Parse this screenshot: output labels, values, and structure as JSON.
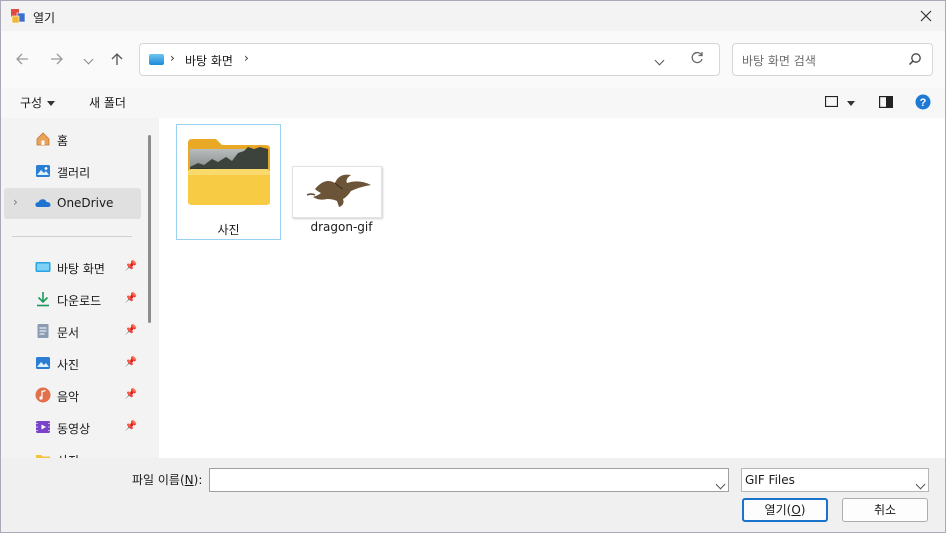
{
  "window": {
    "title": "열기"
  },
  "nav": {
    "breadcrumb": "바탕 화면",
    "search_placeholder": "바탕 화면 검색"
  },
  "commands": {
    "organize": "구성",
    "new_folder": "새 폴더"
  },
  "sidebar": {
    "items": [
      {
        "label": "홈",
        "icon": "home-icon"
      },
      {
        "label": "갤러리",
        "icon": "gallery-icon"
      },
      {
        "label": "OneDrive",
        "icon": "cloud-icon"
      },
      {
        "label": "바탕 화면",
        "icon": "desktop-icon"
      },
      {
        "label": "다운로드",
        "icon": "download-icon"
      },
      {
        "label": "문서",
        "icon": "document-icon"
      },
      {
        "label": "사진",
        "icon": "pictures-icon"
      },
      {
        "label": "음악",
        "icon": "music-icon"
      },
      {
        "label": "동영상",
        "icon": "video-icon"
      },
      {
        "label": "사진",
        "icon": "folder-icon"
      }
    ]
  },
  "files": [
    {
      "name": "사진",
      "type": "folder"
    },
    {
      "name": "dragon-gif",
      "type": "image"
    }
  ],
  "footer": {
    "filename_label_prefix": "파일 이름(",
    "filename_label_key": "N",
    "filename_label_suffix": "):",
    "filename_value": "",
    "filter": "GIF Files",
    "open_prefix": "열기(",
    "open_key": "O",
    "open_suffix": ")",
    "cancel": "취소"
  },
  "colors": {
    "accent": "#1a73c8",
    "selection": "#99d1f3"
  }
}
